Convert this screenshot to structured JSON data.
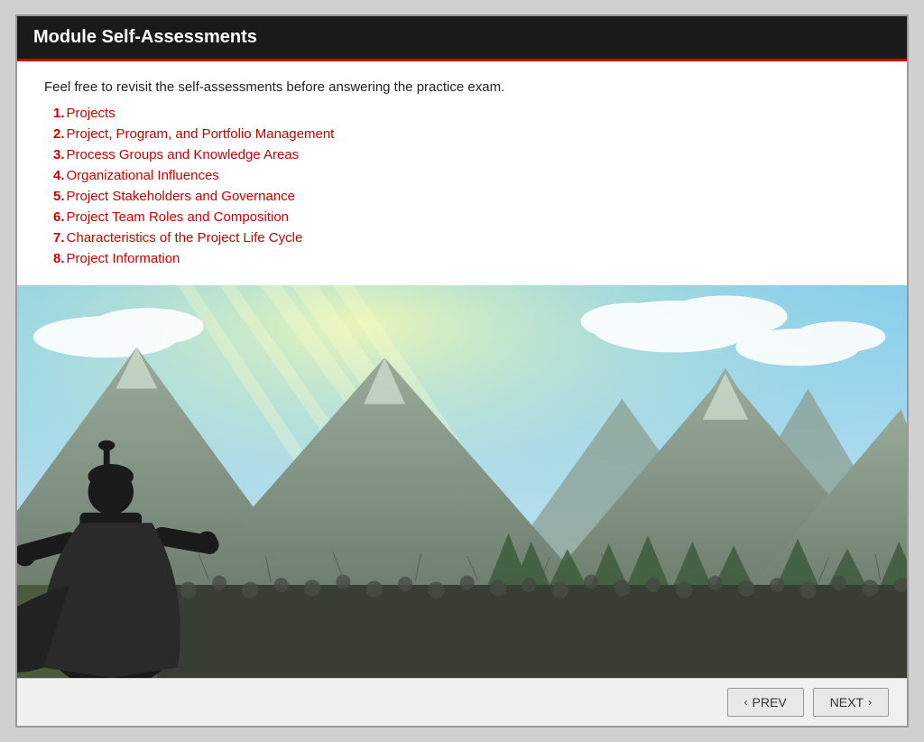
{
  "header": {
    "title": "Module Self-Assessments"
  },
  "content": {
    "intro": "Feel free to revisit the self-assessments before answering the practice exam.",
    "items": [
      {
        "number": "1.",
        "label": "Projects"
      },
      {
        "number": "2.",
        "label": "Project, Program, and Portfolio Management"
      },
      {
        "number": "3.",
        "label": "Process Groups and Knowledge Areas"
      },
      {
        "number": "4.",
        "label": "Organizational Influences"
      },
      {
        "number": "5.",
        "label": "Project Stakeholders and Governance"
      },
      {
        "number": "6.",
        "label": "Project Team Roles and Composition"
      },
      {
        "number": "7.",
        "label": "Characteristics of the Project Life Cycle"
      },
      {
        "number": "8.",
        "label": "Project Information"
      }
    ]
  },
  "navigation": {
    "prev_label": "PREV",
    "next_label": "NEXT",
    "prev_arrow": "‹",
    "next_arrow": "›"
  }
}
